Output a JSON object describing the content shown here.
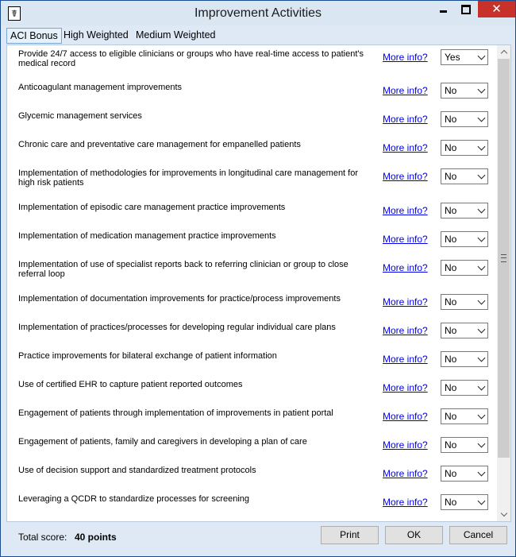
{
  "window": {
    "title": "Improvement Activities",
    "icon": "caduceus-icon",
    "app_icon_glyph": "☤"
  },
  "tabs": [
    {
      "label": "ACI Bonus",
      "active": true
    },
    {
      "label": "High Weighted",
      "active": false
    },
    {
      "label": "Medium Weighted",
      "active": false
    }
  ],
  "more_info_label": "More info?",
  "activities": [
    {
      "text": "Provide 24/7 access to eligible clinicians or groups who have  real-time access to patient's medical record",
      "value": "Yes"
    },
    {
      "text": "Anticoagulant management improvements",
      "value": "No"
    },
    {
      "text": "Glycemic management services",
      "value": "No"
    },
    {
      "text": "Chronic care and preventative care management for empanelled patients",
      "value": "No"
    },
    {
      "text": "Implementation of methodologies for improvements in longitudinal care management for high risk patients",
      "value": "No"
    },
    {
      "text": "Implementation of episodic care management practice improvements",
      "value": "No"
    },
    {
      "text": "Implementation of medication management practice improvements",
      "value": "No"
    },
    {
      "text": "Implementation of use of specialist reports back to referring clinician or group to close referral loop",
      "value": "No"
    },
    {
      "text": "Implementation of documentation improvements for practice/process improvements",
      "value": "No"
    },
    {
      "text": "Implementation of practices/processes for developing regular individual care plans",
      "value": "No"
    },
    {
      "text": "Practice improvements for bilateral exchange of patient information",
      "value": "No"
    },
    {
      "text": "Use of certified EHR to capture patient reported outcomes",
      "value": "No"
    },
    {
      "text": "Engagement of patients through implementation of improvements in patient portal",
      "value": "No"
    },
    {
      "text": "Engagement of patients, family and caregivers in developing a plan of care",
      "value": "No"
    },
    {
      "text": "Use of decision support and standardized treatment protocols",
      "value": "No"
    },
    {
      "text": "Leveraging a QCDR to standardize processes for screening",
      "value": "No"
    }
  ],
  "footer": {
    "total_label": "Total score:",
    "total_value": "40 points",
    "print_label": "Print",
    "ok_label": "OK",
    "cancel_label": "Cancel"
  },
  "colors": {
    "link": "#0000ee",
    "close_button": "#c7312a",
    "title_bar": "#dbe6f3"
  }
}
